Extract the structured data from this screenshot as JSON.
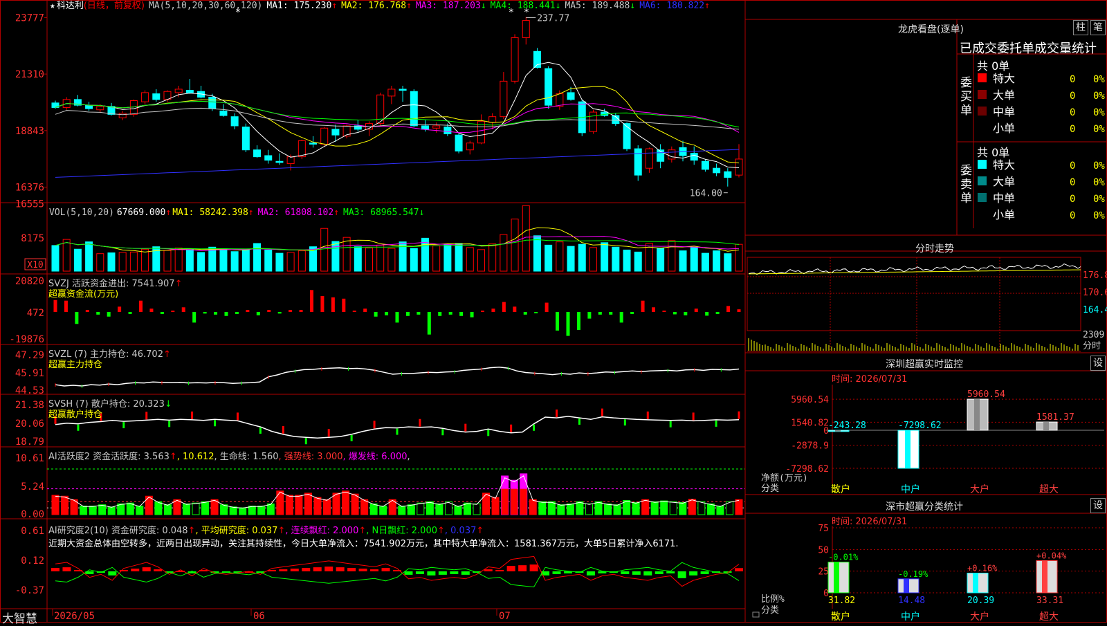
{
  "colors": {
    "up": "#ff0000",
    "down": "#00ffff",
    "grid": "#b00000",
    "ma1": "#ffffff",
    "ma2": "#ffff00",
    "ma3": "#ff00ff",
    "ma4": "#00ff00",
    "ma5": "#c8c8c8",
    "ma6": "#3030ff",
    "yellow": "#ffff00",
    "cyan": "#00ffff",
    "magenta": "#ff00ff",
    "green": "#00ff00"
  },
  "main": {
    "star": "★",
    "stock": "科达利",
    "period": "(日线，前复权)",
    "ma_params": "MA(5,10,20,30,60,120)",
    "ma_values": [
      {
        "label": "MA1:",
        "value": "175.230",
        "arrow": "↑",
        "color": "#ffffff"
      },
      {
        "label": "MA2:",
        "value": "176.768",
        "arrow": "↑",
        "color": "#ffff00"
      },
      {
        "label": "MA3:",
        "value": "187.203",
        "arrow": "↓",
        "color": "#ff00ff"
      },
      {
        "label": "MA4:",
        "value": "188.441",
        "arrow": "↓",
        "color": "#00ff00"
      },
      {
        "label": "MA5:",
        "value": "189.488",
        "arrow": "↓",
        "color": "#c8c8c8"
      },
      {
        "label": "MA6:",
        "value": "180.822",
        "arrow": "↑",
        "color": "#3030ff"
      }
    ],
    "y_labels": [
      "23777",
      "21310",
      "18843",
      "16376"
    ],
    "high_label": "237.77",
    "low_label": "164.00"
  },
  "vol": {
    "header": "VOL(5,10,20)",
    "value": "67669.000",
    "arrow": "↑",
    "mas": [
      {
        "label": "MA1:",
        "value": "58242.398",
        "arrow": "↑",
        "color": "#ffff00"
      },
      {
        "label": "MA2:",
        "value": "61808.102",
        "arrow": "↑",
        "color": "#ff00ff"
      },
      {
        "label": "MA3:",
        "value": "68965.547",
        "arrow": "↓",
        "color": "#00ff00"
      }
    ],
    "y_labels": [
      "16555",
      "8175"
    ],
    "unit": "X10"
  },
  "svzj": {
    "header": "SVZJ  活跃资金进出: 7541.907",
    "arrow": "↑",
    "sub": "超赢资金流(万元)",
    "y_labels": [
      "20820",
      "472",
      "-19876"
    ]
  },
  "svzl": {
    "header": "SVZL (7) 主力持仓: 46.702",
    "arrow": "↑",
    "sub": "超赢主力持仓",
    "y_labels": [
      "47.29",
      "45.91",
      "44.53"
    ]
  },
  "svsh": {
    "header": "SVSH (7) 散户持仓: 20.323",
    "arrow": "↓",
    "sub": "超赢散户持仓",
    "y_labels": [
      "21.38",
      "20.06",
      "18.79"
    ]
  },
  "ai1": {
    "parts": [
      {
        "t": "AI活跃度2 资金活跃度: 3.563",
        "c": "#c8c8c8"
      },
      {
        "t": "↑",
        "c": "#ff0000"
      },
      {
        "t": ", 10.612",
        "c": "#ffff00"
      },
      {
        "t": ", 生命线: 1.560",
        "c": "#c8c8c8"
      },
      {
        "t": ", 强势线: 3.000",
        "c": "#ff3030"
      },
      {
        "t": ", 爆发线: 6.000",
        "c": "#ff00ff"
      },
      {
        "t": ",",
        "c": "#c8c8c8"
      }
    ],
    "y_labels": [
      "10.61",
      "5.24",
      "0.00"
    ]
  },
  "ai2": {
    "parts": [
      {
        "t": "AI研究度2(10) 资金研究度: 0.048",
        "c": "#c8c8c8"
      },
      {
        "t": "↑",
        "c": "#ff0000"
      },
      {
        "t": ", 平均研究度: 0.037",
        "c": "#ffff00"
      },
      {
        "t": "↑",
        "c": "#ff0000"
      },
      {
        "t": ", 连续飘红: 2.000",
        "c": "#ff00ff"
      },
      {
        "t": "↑",
        "c": "#ff0000"
      },
      {
        "t": ", N日飘红: 2.000",
        "c": "#00ff00"
      },
      {
        "t": "↑",
        "c": "#ff0000"
      },
      {
        "t": ", 0.037",
        "c": "#3030ff"
      },
      {
        "t": "↑",
        "c": "#ff0000"
      }
    ],
    "commentary": "近期大资金总体由空转多，近两日出现异动，关注其持续性，今日大单净流入：7541.902万元，其中特大单净流入：1581.367万元，大单5日累计净入6171.",
    "y_labels": [
      "0.61",
      "0.12",
      "-0.37"
    ]
  },
  "bottom": {
    "brand": "大智慧",
    "dates": [
      "2026/05",
      "06",
      "07"
    ]
  },
  "side": {
    "longhu": {
      "title": "龙虎看盘(逐单)",
      "btn1": "柱",
      "btn2": "笔",
      "sub": "已成交委托单成交量统计",
      "buy_label": "委买单",
      "sell_label": "委卖单",
      "buy_total": "共 0单",
      "sell_total": "共 0单",
      "buy_rows": [
        {
          "name": "特大",
          "v": "0",
          "p": "0%",
          "c": "#ff0000"
        },
        {
          "name": "大单",
          "v": "0",
          "p": "0%",
          "c": "#8b0000"
        },
        {
          "name": "中单",
          "v": "0",
          "p": "0%",
          "c": "#6b0000"
        },
        {
          "name": "小单",
          "v": "0",
          "p": "0%",
          "c": ""
        }
      ],
      "sell_rows": [
        {
          "name": "特大",
          "v": "0",
          "p": "0%",
          "c": "#00ffff"
        },
        {
          "name": "大单",
          "v": "0",
          "p": "0%",
          "c": "#008b8b"
        },
        {
          "name": "中单",
          "v": "0",
          "p": "0%",
          "c": "#007070"
        },
        {
          "name": "小单",
          "v": "0",
          "p": "0%",
          "c": ""
        }
      ]
    },
    "intraday": {
      "title": "分时走势",
      "y_labels": [
        "176.8",
        "170.6",
        "164.4",
        "2309"
      ],
      "unit_label": "分时"
    },
    "monitor": {
      "title": "深圳超赢实时监控",
      "btn": "设",
      "time": "时间: 2026/07/31",
      "y_labels": [
        "5960.54",
        "1540.82",
        "0",
        "-2878.9",
        "-7298.62"
      ],
      "ylabel1": "净额(万元)",
      "ylabel2": "分类",
      "categories": [
        "散户",
        "中户",
        "大户",
        "超大"
      ],
      "values": [
        -243.28,
        -7298.62,
        5960.54,
        1581.37
      ],
      "value_labels": [
        "-243.28",
        "-7298.62",
        "5960.54",
        "1581.37"
      ]
    },
    "classify": {
      "title": "深市超赢分类统计",
      "btn": "设",
      "time": "时间: 2026/07/31",
      "y_labels": [
        "75",
        "50",
        "25",
        "0"
      ],
      "ylabel1": "比例%",
      "ylabel2": "分类",
      "categories": [
        "散户",
        "中户",
        "大户",
        "超大"
      ],
      "values": [
        31.82,
        14.48,
        20.39,
        33.31
      ],
      "value_labels": [
        "31.82",
        "14.48",
        "20.39",
        "33.31"
      ],
      "changes": [
        "-0.01%",
        "-0.19%",
        "+0.16%",
        "+0.04%"
      ]
    }
  },
  "chart_data": [
    {
      "type": "candlestick",
      "title": "科达利(日线，前复权)",
      "ylim": [
        163,
        240
      ],
      "high": 237.77,
      "low": 164.0,
      "candles": [
        [
          200.5,
          201.5,
          198.0,
          198.5
        ],
        [
          198.5,
          203.0,
          197.5,
          202.0
        ],
        [
          202.0,
          204.0,
          199.0,
          199.5
        ],
        [
          199.5,
          201.0,
          197.0,
          198.0
        ],
        [
          197.5,
          200.0,
          196.5,
          199.0
        ],
        [
          199.0,
          200.5,
          195.0,
          195.5
        ],
        [
          194.0,
          197.0,
          193.0,
          196.0
        ],
        [
          195.5,
          202.0,
          194.5,
          201.5
        ],
        [
          201.0,
          206.0,
          200.0,
          205.0
        ],
        [
          204.5,
          206.5,
          201.0,
          202.0
        ],
        [
          202.0,
          206.0,
          201.0,
          205.5
        ],
        [
          205.0,
          208.0,
          203.0,
          206.5
        ],
        [
          206.0,
          211.0,
          204.5,
          205.0
        ],
        [
          205.5,
          208.0,
          202.5,
          203.0
        ],
        [
          203.0,
          204.5,
          197.0,
          198.0
        ],
        [
          197.0,
          200.0,
          194.5,
          195.0
        ],
        [
          194.5,
          196.0,
          189.0,
          190.5
        ],
        [
          190.0,
          191.5,
          179.0,
          180.0
        ],
        [
          180.0,
          182.0,
          176.5,
          177.0
        ],
        [
          177.5,
          180.0,
          174.0,
          175.5
        ],
        [
          175.0,
          178.5,
          173.5,
          174.5
        ],
        [
          174.0,
          178.0,
          171.0,
          177.0
        ],
        [
          177.0,
          184.5,
          176.0,
          184.0
        ],
        [
          183.0,
          186.0,
          181.0,
          182.5
        ],
        [
          182.5,
          190.0,
          181.5,
          189.5
        ],
        [
          189.0,
          191.0,
          183.5,
          186.5
        ],
        [
          186.0,
          191.0,
          185.0,
          190.5
        ],
        [
          190.5,
          193.0,
          188.0,
          189.0
        ],
        [
          189.0,
          192.5,
          186.0,
          191.5
        ],
        [
          191.5,
          205.0,
          190.5,
          204.0
        ],
        [
          203.5,
          208.0,
          200.0,
          206.5
        ],
        [
          206.5,
          208.0,
          201.0,
          206.0
        ],
        [
          205.5,
          206.5,
          190.0,
          190.5
        ],
        [
          190.5,
          193.0,
          188.0,
          189.0
        ],
        [
          189.5,
          192.0,
          187.5,
          190.5
        ],
        [
          190.0,
          191.5,
          186.0,
          187.0
        ],
        [
          186.5,
          187.0,
          178.5,
          179.5
        ],
        [
          180.0,
          184.0,
          178.0,
          183.0
        ],
        [
          183.0,
          195.5,
          182.5,
          192.5
        ],
        [
          192.0,
          196.0,
          189.0,
          194.5
        ],
        [
          194.5,
          214.0,
          193.5,
          210.0
        ],
        [
          210.0,
          230.5,
          209.0,
          229.0
        ],
        [
          229.0,
          238.0,
          226.0,
          236.5
        ],
        [
          223.0,
          224.5,
          215.5,
          216.0
        ],
        [
          215.5,
          216.5,
          198.0,
          199.5
        ],
        [
          199.0,
          206.0,
          197.5,
          204.5
        ],
        [
          205.0,
          207.5,
          201.5,
          202.0
        ],
        [
          201.0,
          202.0,
          186.0,
          187.5
        ],
        [
          188.0,
          197.5,
          187.0,
          196.5
        ],
        [
          196.5,
          198.0,
          194.5,
          195.0
        ],
        [
          195.0,
          196.0,
          190.5,
          191.5
        ],
        [
          191.5,
          192.0,
          179.5,
          180.5
        ],
        [
          180.5,
          182.0,
          166.5,
          169.0
        ],
        [
          172.0,
          181.0,
          170.0,
          180.5
        ],
        [
          180.0,
          182.5,
          172.0,
          175.0
        ],
        [
          176.0,
          181.5,
          174.5,
          180.0
        ],
        [
          181.0,
          184.0,
          175.0,
          177.5
        ],
        [
          178.5,
          181.5,
          173.5,
          175.5
        ],
        [
          175.0,
          176.0,
          170.5,
          171.5
        ],
        [
          172.0,
          174.0,
          168.5,
          170.0
        ],
        [
          170.5,
          172.0,
          164.0,
          168.0
        ],
        [
          169.0,
          182.5,
          168.0,
          176.0
        ]
      ]
    },
    {
      "type": "bar",
      "title": "VOL(5,10,20)",
      "ylim": [
        0,
        17000
      ],
      "values": [
        6300,
        7800,
        5400,
        7200,
        4300,
        4500,
        4600,
        4700,
        5400,
        6000,
        5100,
        5700,
        5300,
        4600,
        5900,
        5500,
        4800,
        5200,
        6800,
        5200,
        4400,
        4600,
        5000,
        6000,
        10500,
        7300,
        8300,
        6000,
        5700,
        6400,
        5600,
        7200,
        5600,
        8100,
        6300,
        6600,
        6800,
        5800,
        5300,
        6700,
        9000,
        12800,
        16100,
        8700,
        6400,
        7200,
        6100,
        6600,
        5800,
        7000,
        5900,
        5200,
        4700,
        6800,
        5700,
        7500,
        5000,
        5800,
        4400,
        5000,
        4300,
        6600
      ]
    },
    {
      "type": "bar",
      "title": "SVZJ 活跃资金进出",
      "ylim": [
        -19876,
        20820
      ],
      "values": [
        9000,
        8500,
        -9000,
        1500,
        -2000,
        -3500,
        4000,
        -1500,
        8500,
        2500,
        -1500,
        1000,
        3500,
        -8000,
        -1200,
        -2000,
        -3000,
        -1500,
        1500,
        -2500,
        1500,
        -1200,
        1500,
        1500,
        16500,
        12000,
        11000,
        10000,
        1000,
        2500,
        -3500,
        -2500,
        -8000,
        -3000,
        -2000,
        -17000,
        -3000,
        -2000,
        -3000,
        -4000,
        1000,
        2500,
        7500,
        4000,
        -2000,
        -1000,
        7000,
        -14000,
        -18000,
        -13500,
        -5000,
        -2000,
        -2000,
        -8000,
        -1500,
        8500,
        3500,
        1000,
        -1800,
        -2500,
        2500,
        -2800,
        -1500,
        4500,
        2000
      ]
    },
    {
      "type": "line",
      "title": "SVZL 主力持仓",
      "ylim": [
        44.53,
        47.29
      ],
      "values": [
        44.95,
        44.85,
        44.9,
        44.85,
        44.95,
        44.92,
        45.0,
        44.95,
        45.05,
        45.1,
        45.08,
        45.15,
        45.12,
        45.1,
        45.12,
        45.08,
        45.1,
        45.08,
        45.12,
        45.1,
        45.05,
        45.08,
        45.1,
        45.15,
        45.55,
        45.7,
        45.9,
        46.0,
        46.1,
        46.12,
        46.18,
        46.22,
        46.24,
        46.18,
        46.2,
        46.15,
        46.05,
        45.9,
        45.75,
        45.8,
        45.8,
        45.85,
        45.9,
        45.88,
        45.92,
        45.95,
        46.05,
        46.1,
        46.15,
        46.25,
        46.3,
        46.22,
        46.0,
        45.88,
        45.83,
        45.78,
        45.72,
        45.8,
        45.75,
        45.85,
        45.8,
        45.85,
        45.92,
        45.9,
        45.95,
        46.0,
        45.95,
        46.0,
        46.02,
        46.05,
        46.0,
        46.08,
        46.1,
        46.05,
        46.12,
        46.1,
        46.08,
        46.15
      ]
    },
    {
      "type": "line",
      "title": "SVSH 散户持仓",
      "ylim": [
        18.79,
        21.38
      ],
      "values": [
        20.0,
        20.1,
        20.05,
        20.15,
        20.2,
        20.28,
        20.22,
        20.25,
        20.3,
        20.35,
        20.3,
        20.35,
        20.32,
        20.28,
        20.35,
        20.3,
        20.25,
        20.05,
        19.85,
        19.55,
        19.35,
        19.2,
        19.15,
        19.1,
        19.15,
        19.2,
        19.35,
        19.55,
        19.7,
        19.8,
        19.78,
        19.85,
        19.82,
        19.85,
        19.75,
        19.6,
        19.5,
        19.55,
        19.7,
        19.55,
        19.45,
        19.5,
        20.05,
        20.5,
        20.45,
        20.55,
        20.45,
        20.35,
        20.52,
        20.45,
        20.4,
        20.35,
        20.32,
        20.3,
        20.28,
        20.3,
        20.25,
        20.28,
        20.32,
        20.3,
        20.33
      ]
    },
    {
      "type": "bar",
      "title": "AI活跃度2",
      "ylim": [
        0,
        10.61
      ],
      "values": [
        4.5,
        4.3,
        3.5,
        2.0,
        2.0,
        2.3,
        1.8,
        2.5,
        2.7,
        2.0,
        4.3,
        3.0,
        2.3,
        3.5,
        2.5,
        2.7,
        3.0,
        3.5,
        2.3,
        1.8,
        1.6,
        2.0,
        2.0,
        2.5,
        5.5,
        4.5,
        4.5,
        5.0,
        4.0,
        3.5,
        5.0,
        5.5,
        4.8,
        3.5,
        2.5,
        2.0,
        3.5,
        2.0,
        2.3,
        2.7,
        3.0,
        2.5,
        3.0,
        2.0,
        2.7,
        2.5,
        5.0,
        4.0,
        9.0,
        8.0,
        9.5,
        3.5,
        3.0,
        3.0,
        2.3,
        2.5,
        3.0,
        2.5,
        3.0,
        2.5,
        2.3,
        3.3,
        2.8,
        3.5,
        3.0,
        3.2,
        3.0,
        2.8,
        3.6,
        3.0,
        2.5,
        2.0,
        3.0,
        3.5
      ]
    },
    {
      "type": "bar",
      "title": "AI研究度2(10)",
      "ylim": [
        -0.37,
        0.61
      ],
      "values": [
        0.05,
        0.06,
        0.02,
        -0.04,
        -0.02,
        -0.06,
        0.02,
        0.04,
        0.06,
        0.03,
        -0.02,
        0.01,
        -0.03,
        0.02,
        -0.01,
        -0.02,
        -0.01,
        0.0,
        -0.02,
        0.02,
        0.03,
        0.04,
        0.05,
        0.06,
        0.07,
        0.06,
        0.05,
        0.04,
        0.03,
        0.05,
        0.02,
        -0.05,
        -0.04,
        -0.06,
        -0.05,
        -0.04,
        -0.05,
        -0.02,
        0.03,
        0.02,
        0.08,
        0.09,
        0.1,
        -0.06,
        -0.04,
        -0.03,
        -0.02,
        -0.06,
        -0.03,
        -0.02,
        -0.04,
        -0.05,
        -0.06,
        -0.04,
        -0.03,
        -0.1,
        -0.06,
        -0.04,
        -0.02,
        -0.01,
        0.048
      ]
    },
    {
      "type": "line",
      "title": "分时走势",
      "ylim": [
        164.4,
        176.8
      ]
    },
    {
      "type": "bar",
      "title": "深圳超赢实时监控",
      "categories": [
        "散户",
        "中户",
        "大户",
        "超大"
      ],
      "values": [
        -243.28,
        -7298.62,
        5960.54,
        1581.37
      ],
      "ylabel": "净额(万元)"
    },
    {
      "type": "bar",
      "title": "深市超赢分类统计",
      "categories": [
        "散户",
        "中户",
        "大户",
        "超大"
      ],
      "values": [
        31.82,
        14.48,
        20.39,
        33.31
      ],
      "ylabel": "比例%"
    }
  ]
}
